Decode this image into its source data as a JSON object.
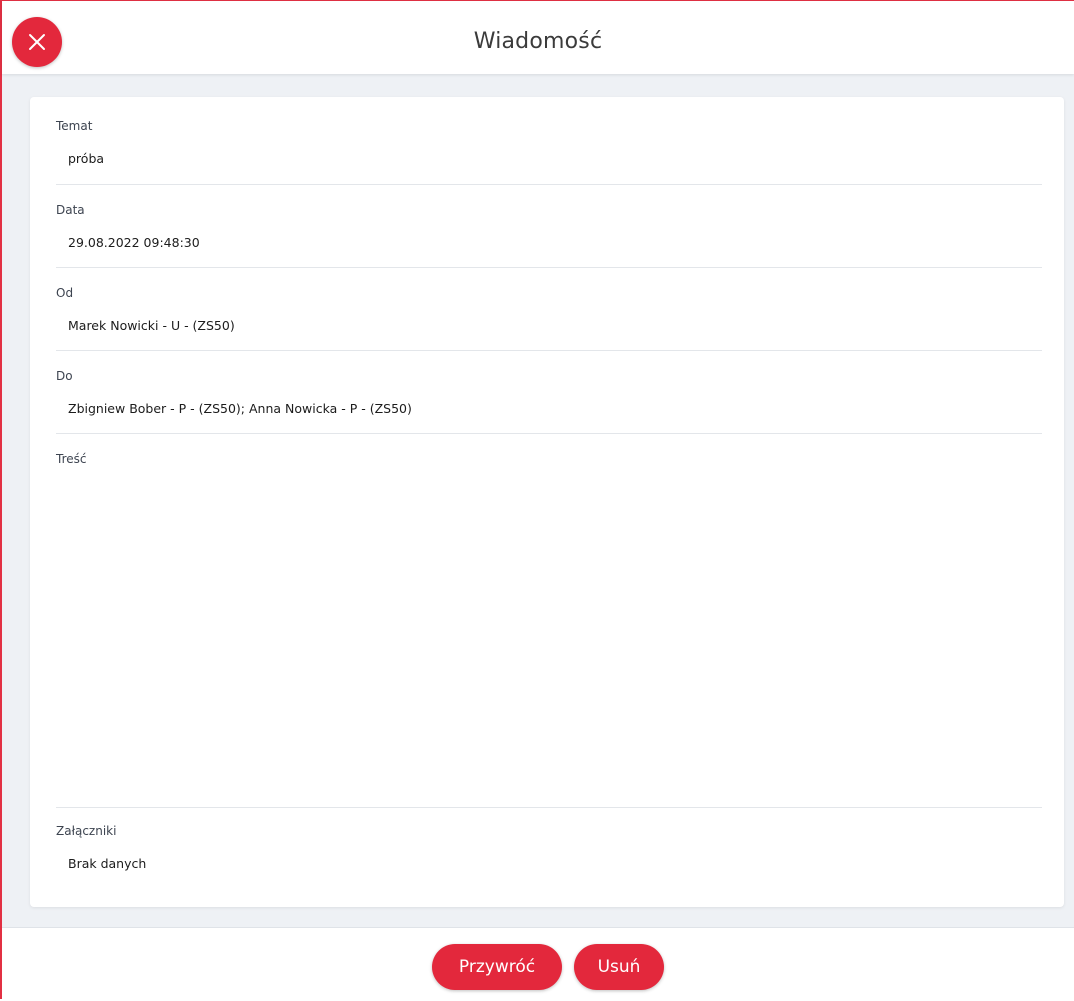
{
  "dialog": {
    "title": "Wiadomość",
    "close_icon": "close-icon"
  },
  "colors": {
    "accent": "#e3283c",
    "background": "#eef1f5"
  },
  "message": {
    "subject": {
      "label": "Temat",
      "value": "próba"
    },
    "date": {
      "label": "Data",
      "value": "29.08.2022 09:48:30"
    },
    "from": {
      "label": "Od",
      "value": "Marek Nowicki - U - (ZS50)"
    },
    "to": {
      "label": "Do",
      "value": "Zbigniew Bober - P - (ZS50); Anna Nowicka - P - (ZS50)"
    },
    "body": {
      "label": "Treść",
      "value": ""
    },
    "attachments": {
      "label": "Załączniki",
      "value": "Brak danych"
    }
  },
  "footer": {
    "restore_label": "Przywróć",
    "delete_label": "Usuń"
  }
}
